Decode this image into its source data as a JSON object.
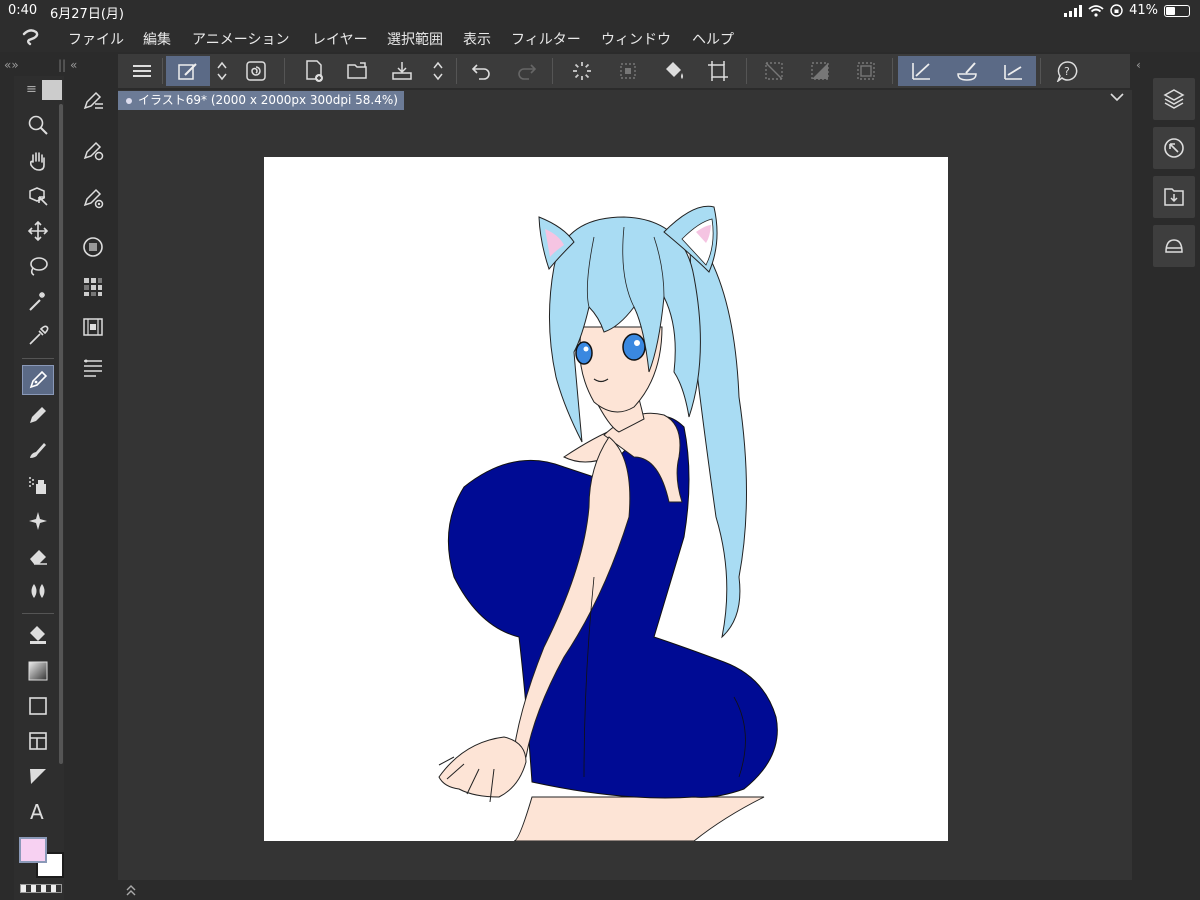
{
  "status": {
    "time": "0:40",
    "date": "6月27日(月)",
    "battery": "41%",
    "battery_level": 0.41
  },
  "menu": [
    "ファイル",
    "編集",
    "アニメーション",
    "レイヤー",
    "選択範囲",
    "表示",
    "フィルター",
    "ウィンドウ",
    "ヘルプ"
  ],
  "document": {
    "tab_label": "イラスト69* (2000 x 2000px 300dpi 58.4%)",
    "zoom": "58.4%"
  },
  "colors": {
    "accent": "#5b6a86",
    "main_color": "#f7d1f2",
    "sub_color": "#ffffff",
    "hair": "#a9dcf3",
    "swimsuit": "#000b94",
    "skin": "#fde4d6"
  },
  "tools": [
    "zoom-icon",
    "hand-icon",
    "object-icon",
    "move-icon",
    "lasso-icon",
    "magic-wand-icon",
    "eyedropper-icon",
    "pen-icon",
    "pencil-icon",
    "brush-icon",
    "airbrush-icon",
    "decoration-icon",
    "eraser-icon",
    "blend-icon",
    "fill-icon",
    "gradient-icon",
    "shape-icon",
    "frame-icon",
    "ruler-icon",
    "text-icon"
  ],
  "subtools": [
    "subtool-pen-icon",
    "subtool-settings-icon",
    "subtool-detail-icon",
    "color-circle-icon",
    "color-set-icon",
    "timeline-icon",
    "layer-property-icon"
  ],
  "command_icons": [
    "menu-icon",
    "modify-icon",
    "spinner-icon",
    "scroll-icon",
    "new-icon",
    "open-icon",
    "save-icon",
    "updown-icon",
    "undo-icon",
    "redo-icon",
    "loading-icon",
    "transform-icon",
    "fill-command-icon",
    "crop-icon",
    "deselect-icon",
    "invert-icon",
    "border-icon",
    "vector-snap-icon",
    "brush-snap-icon",
    "ruler-snap-icon",
    "help-icon"
  ],
  "right_panel": [
    "layer-icon",
    "navigator-icon",
    "download-icon",
    "material-icon"
  ]
}
